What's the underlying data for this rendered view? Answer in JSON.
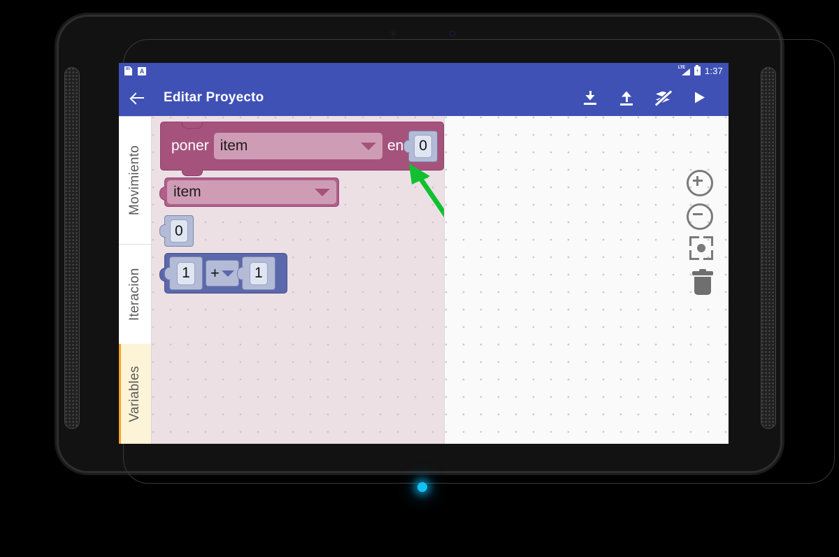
{
  "device": {
    "status_bar": {
      "left_icons": [
        "sd-card-icon",
        "app-notification-icon"
      ],
      "network_label": "LTE",
      "time": "1:37"
    },
    "nav_bar": {
      "back": "back-nav-button",
      "home": "home-nav-button",
      "recents": "recents-nav-button"
    },
    "led_color": "#11c3f2"
  },
  "appbar": {
    "back_label": "back-arrow",
    "title": "Editar Proyecto",
    "actions": [
      {
        "name": "download-button",
        "icon": "download-icon"
      },
      {
        "name": "upload-button",
        "icon": "upload-icon"
      },
      {
        "name": "layers-off-button",
        "icon": "layers-off-icon"
      },
      {
        "name": "run-button",
        "icon": "play-icon"
      }
    ],
    "bg": "#3f51b5"
  },
  "toolbox": {
    "categories": [
      {
        "label": "Movimiento",
        "selected": false
      },
      {
        "label": "Iteracion",
        "selected": false
      },
      {
        "label": "Variables",
        "selected": true,
        "accent": "#f5a623",
        "bg": "#fdf3d7"
      }
    ]
  },
  "flyout": {
    "bg": "#ece0e5",
    "blocks": {
      "set_block": {
        "label_left": "poner",
        "dropdown_value": "item",
        "label_right": "en",
        "value": "0",
        "color": "#a5537c"
      },
      "variable_getter": {
        "dropdown_value": "item",
        "color": "#b0608a"
      },
      "number_block": {
        "value": "0",
        "color": "#5b68ac"
      },
      "math_block": {
        "left_value": "1",
        "operator": "+",
        "right_value": "1",
        "color": "#5b68ac"
      }
    }
  },
  "workspace": {
    "bg": "#fafafa",
    "controls": [
      {
        "name": "zoom-in-button",
        "icon": "zoom-in-icon"
      },
      {
        "name": "zoom-out-button",
        "icon": "zoom-out-icon"
      },
      {
        "name": "center-blocks-button",
        "icon": "center-target-icon"
      },
      {
        "name": "trash-button",
        "icon": "trash-icon"
      }
    ]
  },
  "annotation": {
    "arrow_color": "#10c030",
    "points_at": "set-block-en-socket"
  }
}
